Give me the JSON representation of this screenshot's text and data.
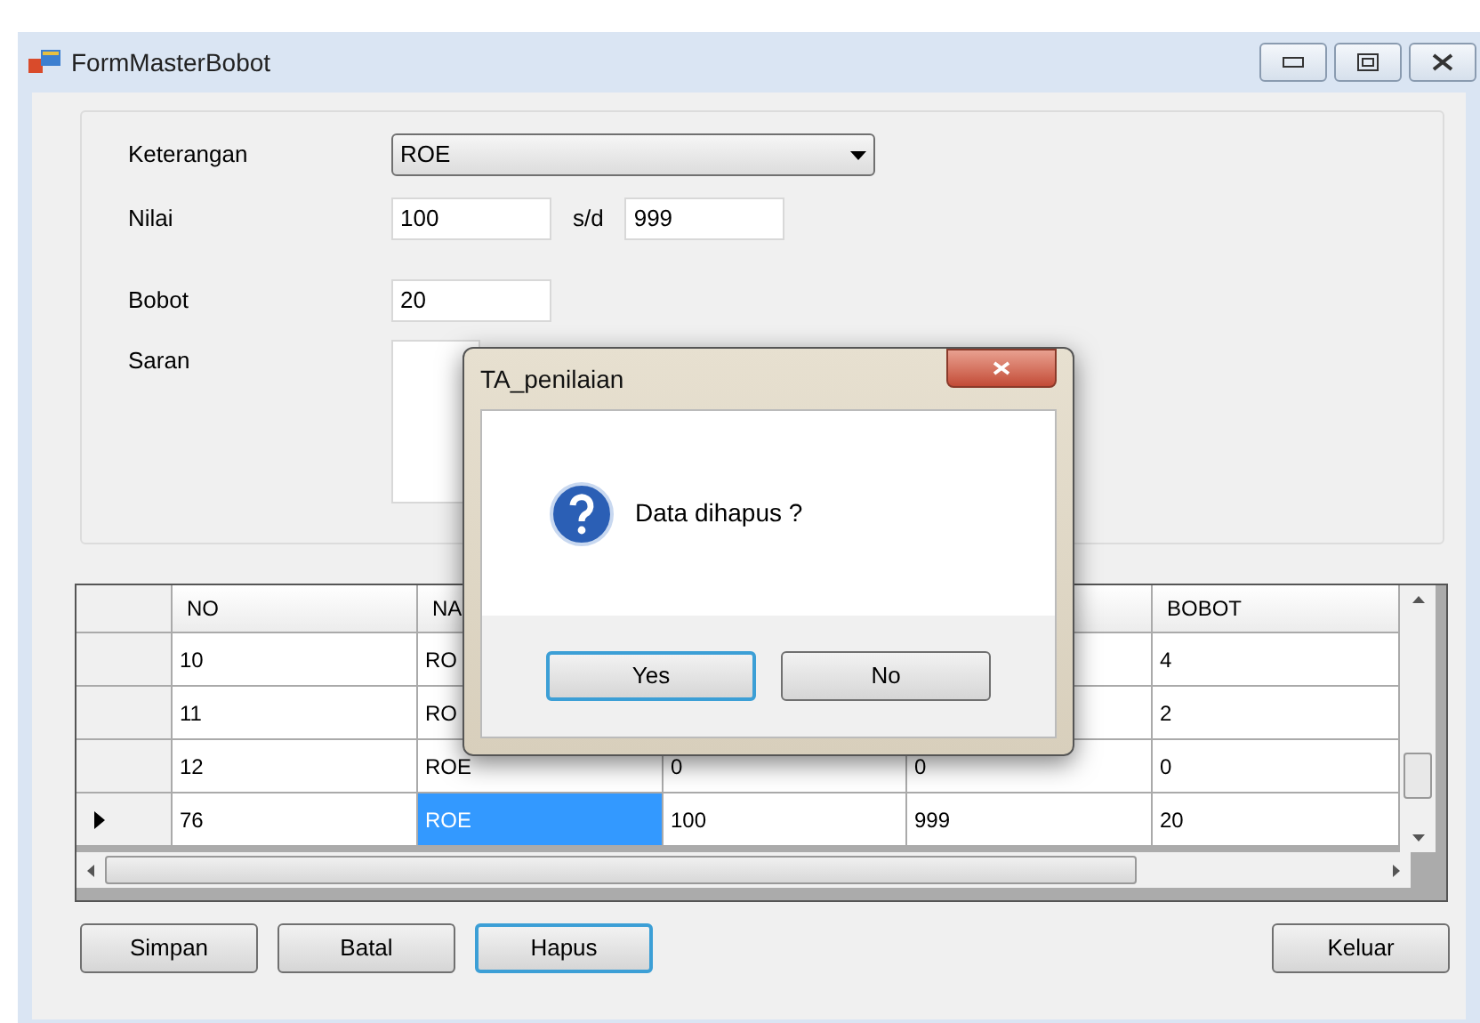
{
  "window": {
    "title": "FormMasterBobot"
  },
  "form": {
    "fields": [
      {
        "kind": "combo",
        "label": "Keterangan",
        "value": "ROE"
      },
      {
        "kind": "range",
        "label": "Nilai",
        "value": "100",
        "separator": "s/d",
        "value2": "999"
      },
      {
        "kind": "text",
        "label": "Bobot",
        "value": "20"
      },
      {
        "kind": "memo",
        "label": "Saran"
      }
    ]
  },
  "table": {
    "columns": [
      "NO",
      "NA",
      null,
      null,
      "BOBOT"
    ],
    "rows": [
      {
        "selected": false,
        "cells": [
          {
            "text": "10",
            "selected": false
          },
          {
            "text": "RO",
            "selected": false
          },
          null,
          null,
          {
            "text": "4",
            "selected": false
          }
        ]
      },
      {
        "selected": false,
        "cells": [
          {
            "text": "11",
            "selected": false
          },
          {
            "text": "RO",
            "selected": false
          },
          null,
          null,
          {
            "text": "2",
            "selected": false
          }
        ]
      },
      {
        "selected": false,
        "cells": [
          {
            "text": "12",
            "selected": false
          },
          {
            "text": "ROE",
            "selected": false
          },
          {
            "text": "0",
            "selected": false
          },
          {
            "text": "0",
            "selected": false
          },
          {
            "text": "0",
            "selected": false
          }
        ]
      },
      {
        "selected": true,
        "cells": [
          {
            "text": "76",
            "selected": false
          },
          {
            "text": "ROE",
            "selected": true
          },
          {
            "text": "100",
            "selected": false
          },
          {
            "text": "999",
            "selected": false
          },
          {
            "text": "20",
            "selected": false
          }
        ]
      }
    ]
  },
  "buttons": [
    {
      "label": "Simpan",
      "focused": false
    },
    {
      "label": "Batal",
      "focused": false
    },
    {
      "label": "Hapus",
      "focused": true
    },
    {
      "label": "Keluar",
      "focused": false
    }
  ],
  "dialog": {
    "title": "TA_penilaian",
    "message": "Data dihapus ?",
    "buttons": [
      {
        "label": "Yes",
        "focused": true
      },
      {
        "label": "No",
        "focused": false
      }
    ]
  }
}
